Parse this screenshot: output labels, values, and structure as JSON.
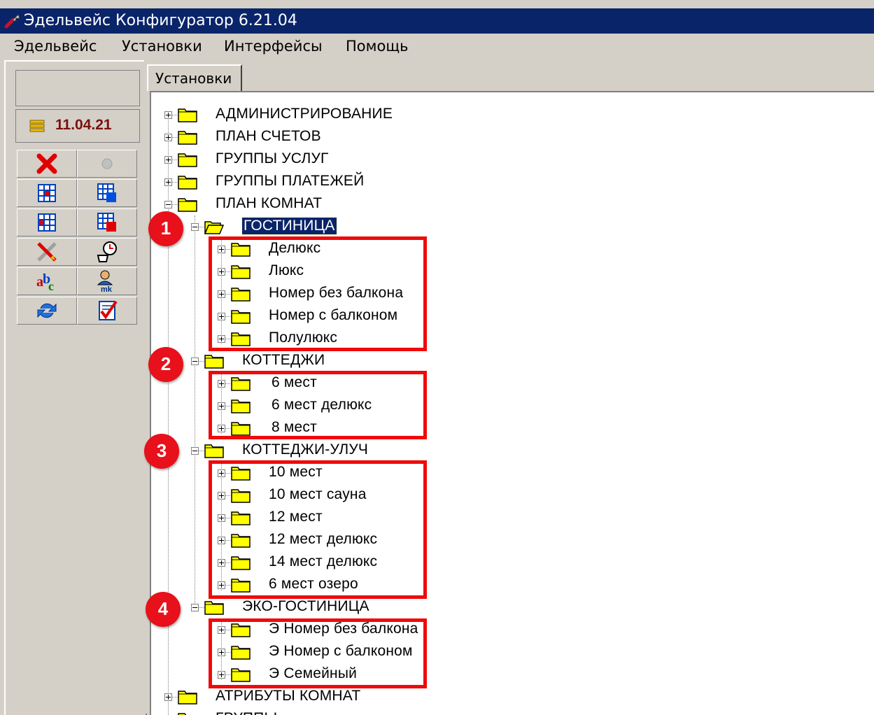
{
  "window": {
    "title": "Эдельвейс Конфигуратор 6.21.04"
  },
  "menu": [
    "Эдельвейс",
    "Установки",
    "Интерфейсы",
    "Помощь"
  ],
  "left_panel": {
    "status_text": "",
    "date": "11.04.21",
    "buttons": [
      "delete-icon",
      "record-icon",
      "grid-icon",
      "grid-add-icon",
      "grid-red-icon",
      "grid-delete-icon",
      "tools-icon",
      "coffee-clock-icon",
      "abc-icon",
      "user-mk-icon",
      "refresh-icon",
      "checklist-icon"
    ]
  },
  "tab": {
    "label": "Установки"
  },
  "tree": [
    {
      "label": "АДМИНИСТРИРОВАНИЕ"
    },
    {
      "label": "ПЛАН СЧЕТОВ"
    },
    {
      "label": "ГРУППЫ УСЛУГ"
    },
    {
      "label": "ГРУППЫ ПЛАТЕЖЕЙ"
    },
    {
      "label": "ПЛАН КОМНАТ"
    },
    {
      "label": "ГОСТИНИЦА"
    },
    {
      "label": "Делюкс"
    },
    {
      "label": "Люкс"
    },
    {
      "label": "Номер без балкона"
    },
    {
      "label": "Номер с балконом"
    },
    {
      "label": "Полулюкс"
    },
    {
      "label": "КОТТЕДЖИ"
    },
    {
      "label": " 6 мест"
    },
    {
      "label": " 6 мест делюкс"
    },
    {
      "label": " 8 мест"
    },
    {
      "label": "КОТТЕДЖИ-УЛУЧ"
    },
    {
      "label": "10 мест"
    },
    {
      "label": "10 мест сауна"
    },
    {
      "label": "12 мест"
    },
    {
      "label": "12 мест делюкс"
    },
    {
      "label": "14 мест делюкс"
    },
    {
      "label": "6 мест озеро"
    },
    {
      "label": "ЭКО-ГОСТИНИЦА"
    },
    {
      "label": "Э Номер без балкона"
    },
    {
      "label": "Э Номер с балконом"
    },
    {
      "label": "Э Семейный"
    },
    {
      "label": "АТРИБУТЫ КОМНАТ"
    },
    {
      "label": "ГРУППЫ"
    }
  ],
  "badges": [
    "1",
    "2",
    "3",
    "4"
  ],
  "colors": {
    "selection": "#0a246a",
    "highlight": "#f00a0a",
    "badge": "#e8101a",
    "folder": "#ffff00"
  }
}
